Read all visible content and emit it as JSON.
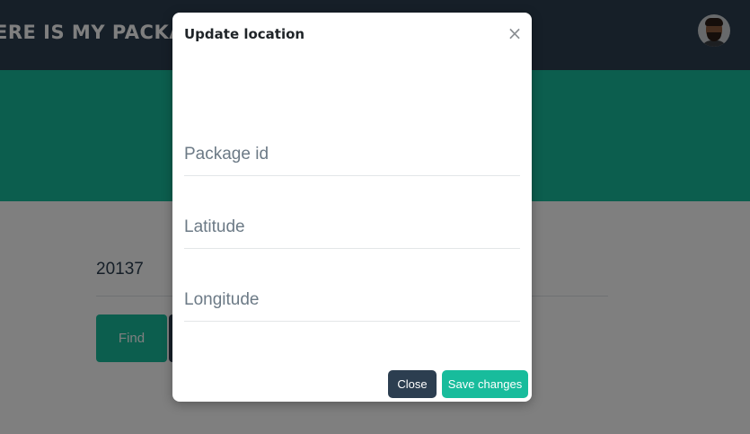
{
  "navbar": {
    "brand": "ERE IS MY PACKA"
  },
  "search": {
    "package_value": "20137",
    "find_label": "Find"
  },
  "modal": {
    "title": "Update location",
    "close_symbol": "×",
    "fields": [
      {
        "placeholder": "Package id"
      },
      {
        "placeholder": "Latitude"
      },
      {
        "placeholder": "Longitude"
      }
    ],
    "close_label": "Close",
    "save_label": "Save changes"
  },
  "icons": {
    "close": "close-icon",
    "avatar": "user-avatar"
  },
  "colors": {
    "navbar": "#2c3e50",
    "accent": "#18bc9c",
    "backdrop": "rgba(0,0,0,0.5)"
  }
}
